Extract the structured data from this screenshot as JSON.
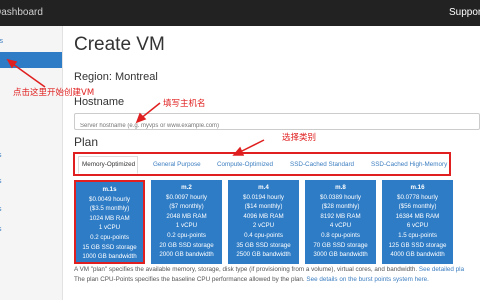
{
  "topbar": {
    "brand": "Dashboard",
    "support": "Support"
  },
  "sidebar": {
    "items": [
      {
        "label": "ls"
      },
      {
        "label": ""
      },
      {
        "label": ""
      },
      {
        "label": "s"
      },
      {
        "label": "s"
      },
      {
        "label": "s"
      },
      {
        "label": "s"
      }
    ]
  },
  "page": {
    "title": "Create VM",
    "region_label": "Region: Montreal",
    "hostname_label": "Hostname",
    "hostname_placeholder": "Server hostname (e.g. myvps or www.example.com)",
    "plan_label": "Plan"
  },
  "tabs": [
    {
      "label": "Memory-Optimized",
      "active": true
    },
    {
      "label": "General Purpose"
    },
    {
      "label": "Compute-Optimized"
    },
    {
      "label": "SSD-Cached Standard"
    },
    {
      "label": "SSD-Cached High-Memory"
    }
  ],
  "plans": [
    {
      "name": "m.1s",
      "hourly": "$0.0049 hourly",
      "monthly": "($3.5 monthly)",
      "ram": "1024 MB RAM",
      "vcpu": "1 vCPU",
      "cpu_points": "0.2 cpu-points",
      "storage": "15 GB SSD storage",
      "bandwidth": "1000 GB bandwidth",
      "selected": true
    },
    {
      "name": "m.2",
      "hourly": "$0.0097 hourly",
      "monthly": "($7 monthly)",
      "ram": "2048 MB RAM",
      "vcpu": "1 vCPU",
      "cpu_points": "0.2 cpu-points",
      "storage": "20 GB SSD storage",
      "bandwidth": "2000 GB bandwidth"
    },
    {
      "name": "m.4",
      "hourly": "$0.0194 hourly",
      "monthly": "($14 monthly)",
      "ram": "4096 MB RAM",
      "vcpu": "2 vCPU",
      "cpu_points": "0.4 cpu-points",
      "storage": "35 GB SSD storage",
      "bandwidth": "2500 GB bandwidth"
    },
    {
      "name": "m.8",
      "hourly": "$0.0389 hourly",
      "monthly": "($28 monthly)",
      "ram": "8192 MB RAM",
      "vcpu": "4 vCPU",
      "cpu_points": "0.8 cpu-points",
      "storage": "70 GB SSD storage",
      "bandwidth": "3000 GB bandwidth"
    },
    {
      "name": "m.16",
      "hourly": "$0.0778 hourly",
      "monthly": "($56 monthly)",
      "ram": "16384 MB RAM",
      "vcpu": "6 vCPU",
      "cpu_points": "1.5 cpu-points",
      "storage": "125 GB SSD storage",
      "bandwidth": "4000 GB bandwidth"
    }
  ],
  "footnotes": {
    "line1": "A VM \"plan\" specifies the available memory, storage, disk type (if provisioning from a volume), virtual cores, and bandwidth.",
    "line1_link": "See detailed pla",
    "line2": "The plan CPU-Points specifies the baseline CPU performance allowed by the plan.",
    "line2_link": "See details on the burst points system here."
  },
  "annotations": {
    "click_create": "点击这里开始创建VM",
    "fill_hostname": "填写主机名",
    "choose_type": "选择类别"
  },
  "colors": {
    "accent": "#2e7cc6",
    "annotation": "#e02020",
    "topbar": "#222222"
  }
}
